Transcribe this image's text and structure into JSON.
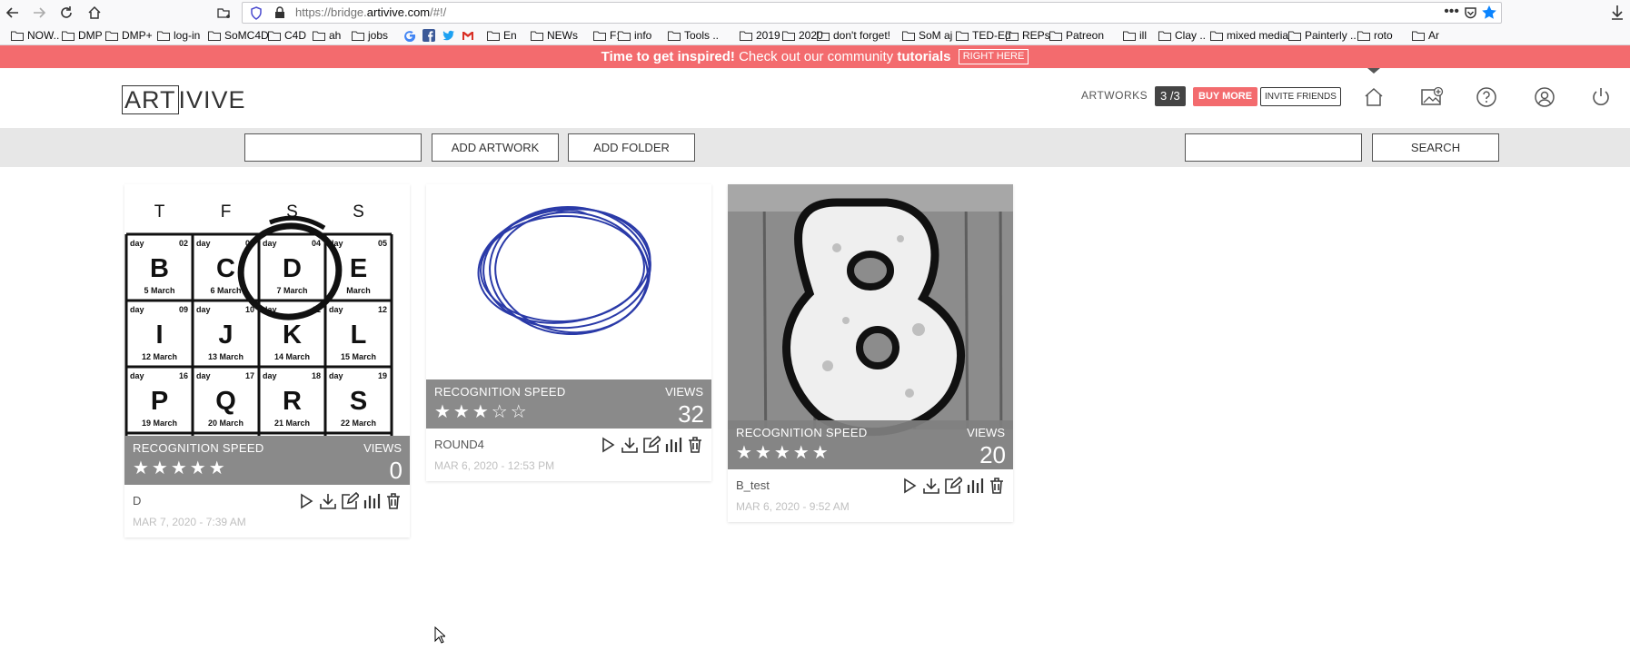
{
  "browser": {
    "url_prefix": "https://bridge.",
    "url_host": "artivive.com",
    "url_path": "/#!/",
    "more": "•••",
    "bookmarks": [
      "NOW..",
      "DMP",
      "DMP+",
      "log-in",
      "SoMC4D",
      "C4D",
      "ah",
      "jobs",
      "En",
      "NEWs",
      "F:",
      "info",
      "Tools ..",
      "2019",
      "2020",
      "don't forget!",
      "SoM aj",
      "TED-Ed",
      "REPs",
      "Patreon",
      "ill",
      "Clay ..",
      "mixed media",
      "Painterly ..",
      "roto",
      "Ar"
    ]
  },
  "banner": {
    "lead": "Time to get inspired!",
    "middle": " Check out our community ",
    "bold": "tutorials",
    "button": "RIGHT HERE"
  },
  "header": {
    "logo_boxed": "ART",
    "logo_rest": "IVIVE",
    "artworks_label": "ARTWORKS",
    "count": "3 /3",
    "buy_more": "BUY MORE",
    "invite": "INVITE FRIENDS"
  },
  "toolbar": {
    "add_artwork": "ADD ARTWORK",
    "add_folder": "ADD FOLDER",
    "search": "SEARCH",
    "folder_input_value": "",
    "search_input_value": ""
  },
  "cards": [
    {
      "rs_label": "RECOGNITION SPEED",
      "views_label": "VIEWS",
      "rating": 5,
      "rating_max": 5,
      "views": "0",
      "name": "D",
      "date": "MAR 7, 2020 - 7:39 AM",
      "calendar": {
        "headers": [
          "T",
          "F",
          "S",
          "S"
        ],
        "cells": [
          {
            "day": "day",
            "num": "02",
            "letter": "B",
            "date": "5 March"
          },
          {
            "day": "day",
            "num": "03",
            "letter": "C",
            "date": "6 March"
          },
          {
            "day": "day",
            "num": "04",
            "letter": "D",
            "date": "7 March"
          },
          {
            "day": "day",
            "num": "05",
            "letter": "E",
            "date": "March"
          },
          {
            "day": "day",
            "num": "09",
            "letter": "I",
            "date": "12 March"
          },
          {
            "day": "day",
            "num": "10",
            "letter": "J",
            "date": "13 March"
          },
          {
            "day": "day",
            "num": "11",
            "letter": "K",
            "date": "14 March"
          },
          {
            "day": "day",
            "num": "12",
            "letter": "L",
            "date": "15 March"
          },
          {
            "day": "day",
            "num": "16",
            "letter": "P",
            "date": "19 March"
          },
          {
            "day": "day",
            "num": "17",
            "letter": "Q",
            "date": "20 March"
          },
          {
            "day": "day",
            "num": "18",
            "letter": "R",
            "date": "21 March"
          },
          {
            "day": "day",
            "num": "19",
            "letter": "S",
            "date": "22 March"
          }
        ]
      }
    },
    {
      "rs_label": "RECOGNITION SPEED",
      "views_label": "VIEWS",
      "rating": 3,
      "rating_max": 5,
      "views": "32",
      "name": "ROUND4",
      "date": "MAR 6, 2020 - 12:53 PM"
    },
    {
      "rs_label": "RECOGNITION SPEED",
      "views_label": "VIEWS",
      "rating": 5,
      "rating_max": 5,
      "views": "20",
      "name": "B_test",
      "date": "MAR 6, 2020 - 9:52 AM"
    }
  ],
  "colors": {
    "accent": "#f36b6e",
    "dark": "#444444",
    "toolbar_bg": "#e7e7e7",
    "info_bar": "#808080"
  }
}
